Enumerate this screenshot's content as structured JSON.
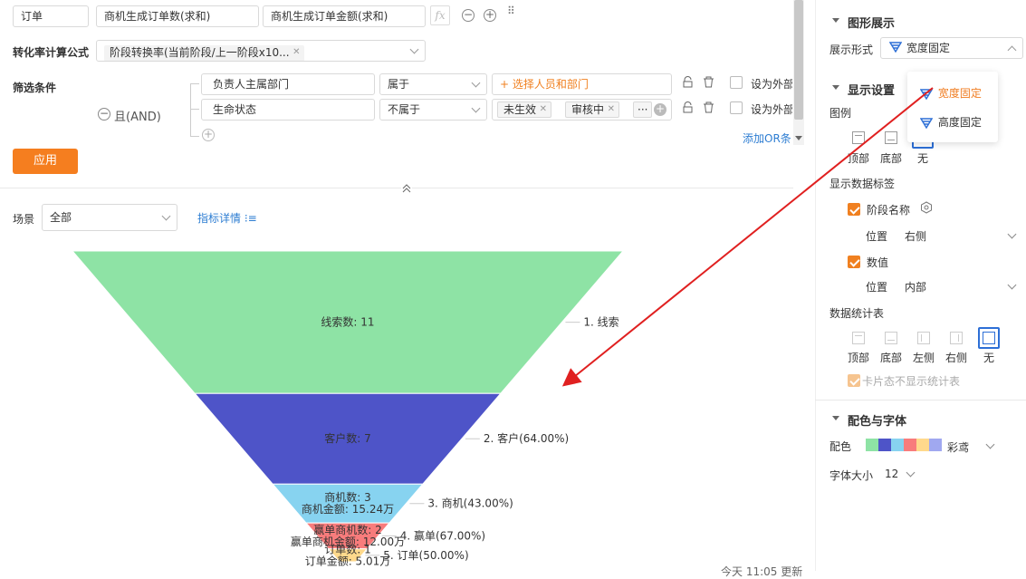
{
  "header": {
    "field1": "订单",
    "field2": "商机生成订单数(求和)",
    "field3": "商机生成订单金额(求和)",
    "fx_icon": "fx-icon"
  },
  "formula": {
    "label": "转化率计算公式",
    "value": "阶段转换率(当前阶段/上一阶段x10..."
  },
  "filter": {
    "label": "筛选条件",
    "and_label": "且(AND)",
    "row1": {
      "field": "负责人主属部门",
      "op": "属于",
      "value_placeholder": "+ 选择人员和部门",
      "ext": "设为外部"
    },
    "row2": {
      "field": "生命状态",
      "op": "不属于",
      "tags": [
        "未生效",
        "审核中"
      ],
      "more": "···",
      "ext": "设为外部"
    },
    "add_or": "添加OR条",
    "apply": "应用"
  },
  "scene": {
    "label": "场景",
    "value": "全部",
    "details": "指标详情"
  },
  "chart_data": {
    "type": "funnel",
    "stages": [
      {
        "name": "线索",
        "inner": [
          "线索数: 11"
        ],
        "label": "1. 线索",
        "value": 11,
        "color": "#8ee3a5"
      },
      {
        "name": "客户",
        "inner": [
          "客户数: 7"
        ],
        "label": "2. 客户(64.00%)",
        "value": 7,
        "color": "#4e54c8"
      },
      {
        "name": "商机",
        "inner": [
          "商机数: 3",
          "商机金额: 15.24万"
        ],
        "label": "3. 商机(43.00%)",
        "value": 3,
        "color": "#87d3f0"
      },
      {
        "name": "赢单",
        "inner": [
          "赢单商机数: 2",
          "赢单商机金额: 12.00万"
        ],
        "label": "4. 赢单(67.00%)",
        "value": 2,
        "color": "#f87c7c"
      },
      {
        "name": "订单",
        "inner": [
          "订单数: 1",
          "订单金额: 5.01万"
        ],
        "label": "5. 订单(50.00%)",
        "value": 1,
        "color": "#ffd98c"
      }
    ]
  },
  "footer": {
    "updated": "今天 11:05 更新"
  },
  "panel": {
    "graph_section": "图形展示",
    "display_form_label": "展示形式",
    "display_form_value": "宽度固定",
    "dropdown_options": [
      "宽度固定",
      "高度固定"
    ],
    "display_settings": "显示设置",
    "legend_label": "图例",
    "legend_options": [
      "顶部",
      "底部",
      "无"
    ],
    "data_label_title": "显示数据标签",
    "stage_name": "阶段名称",
    "position_label": "位置",
    "stage_position": "右侧",
    "value_label": "数值",
    "value_position": "内部",
    "stats_table": "数据统计表",
    "stats_options": [
      "顶部",
      "底部",
      "左侧",
      "右侧",
      "无"
    ],
    "card_hide": "卡片态不显示统计表",
    "color_font": "配色与字体",
    "color_label": "配色",
    "color_name": "彩鸢",
    "palette": [
      "#8ee3a5",
      "#4e54c8",
      "#87d3f0",
      "#f87c7c",
      "#ffd98c",
      "#a0a8f0"
    ],
    "font_size_label": "字体大小",
    "font_size": "12"
  }
}
